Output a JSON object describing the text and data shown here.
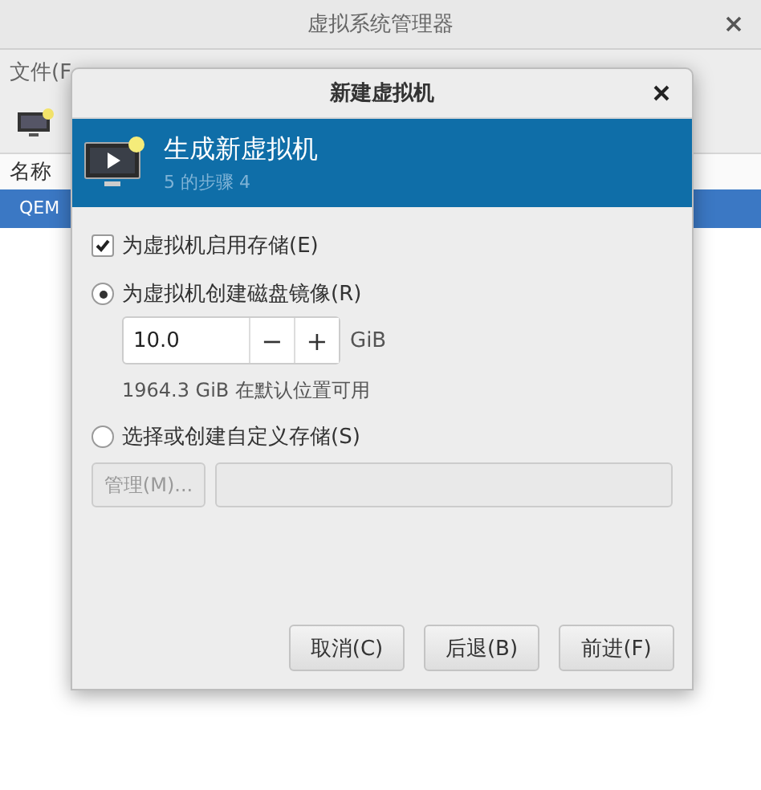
{
  "main_window": {
    "title": "虚拟系统管理器",
    "menu": [
      "文件(F"
    ],
    "list_header": "名称",
    "rows": [
      {
        "name": "QEM",
        "selected": true
      }
    ]
  },
  "dialog": {
    "title": "新建虚拟机",
    "banner": {
      "title": "生成新虚拟机",
      "subtitle": "5 的步骤 4"
    },
    "enable_storage": {
      "label": "为虚拟机启用存储(E)",
      "checked": true
    },
    "options": [
      {
        "kind": "create",
        "label": "为虚拟机创建磁盘镜像(R)",
        "selected": true,
        "size": "10.0",
        "minus": "−",
        "plus": "+",
        "unit": "GiB",
        "note": "1964.3 GiB 在默认位置可用"
      },
      {
        "kind": "custom",
        "label": "选择或创建自定义存储(S)",
        "selected": false,
        "manage": "管理(M)..."
      }
    ],
    "buttons": [
      "取消(C)",
      "后退(B)",
      "前进(F)"
    ]
  }
}
